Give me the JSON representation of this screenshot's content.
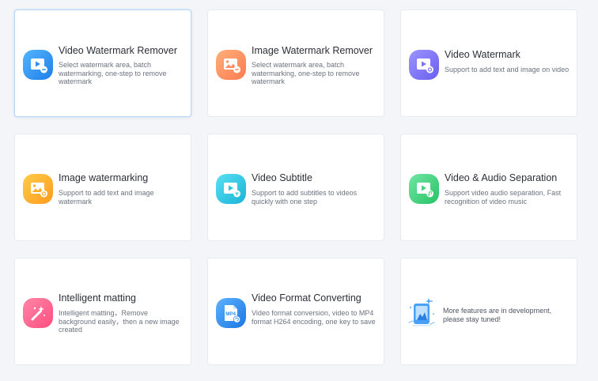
{
  "cards": [
    {
      "id": "video-watermark-remover",
      "title": "Video Watermark Remover",
      "desc": "Select watermark area, batch watermarking, one-step to remove watermark",
      "icon": "video-watermark-remover-icon",
      "color": "#2f8ef0"
    },
    {
      "id": "image-watermark-remover",
      "title": "Image Watermark Remover",
      "desc": "Select watermark area, batch watermarking, one-step to remove watermark",
      "icon": "image-watermark-remover-icon",
      "color": "#ff8f63"
    },
    {
      "id": "video-watermark",
      "title": "Video Watermark",
      "desc": "Support to add text and image on video",
      "icon": "video-watermark-icon",
      "color": "#7c73f5"
    },
    {
      "id": "image-watermarking",
      "title": "Image watermarking",
      "desc": "Support to add text and image watermark",
      "icon": "image-watermarking-icon",
      "color": "#ffae2a"
    },
    {
      "id": "video-subtitle",
      "title": "Video Subtitle",
      "desc": "Support to add subtitles to videos quickly with one step",
      "icon": "video-subtitle-icon",
      "color": "#28c7e5"
    },
    {
      "id": "video-audio-separation",
      "title": "Video & Audio Separation",
      "desc": "Support video audio separation, Fast recognition of video music",
      "icon": "video-audio-separation-icon",
      "color": "#3fd27a"
    },
    {
      "id": "intelligent-matting",
      "title": "Intelligent matting",
      "desc": "Intelligent matting，Remove background easily，then a new image created",
      "icon": "intelligent-matting-icon",
      "color": "#ff5d8b"
    },
    {
      "id": "video-format-converting",
      "title": "Video Format Converting",
      "desc": "Video format conversion, video to MP4 format H264 encoding, one key to save",
      "icon": "video-format-converting-icon",
      "color": "#2d8ff0"
    }
  ],
  "development": {
    "text": "More features are in development, please stay tuned!",
    "icon": "development-illustration-icon"
  },
  "format_badge": "MP4"
}
